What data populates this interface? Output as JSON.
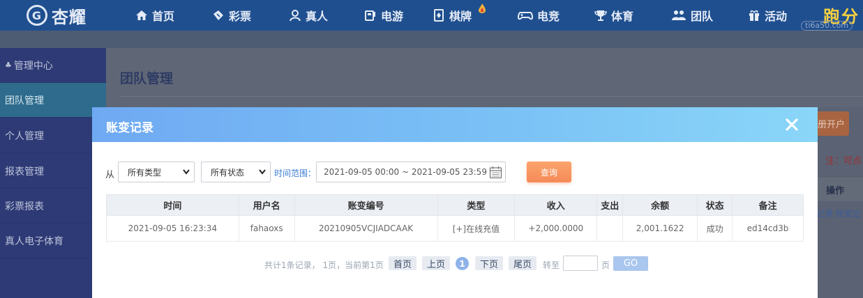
{
  "brand": {
    "logo_text": "杏耀",
    "logo_badge": "G",
    "right_brand": "跑分",
    "watermark": "ti6a50.com"
  },
  "nav": [
    {
      "label": "首页",
      "icon": "home-icon"
    },
    {
      "label": "彩票",
      "icon": "ticket-icon"
    },
    {
      "label": "真人",
      "icon": "person-icon"
    },
    {
      "label": "电游",
      "icon": "slot-icon"
    },
    {
      "label": "棋牌",
      "icon": "cards-icon"
    },
    {
      "label": "电竞",
      "icon": "gamepad-icon"
    },
    {
      "label": "体育",
      "icon": "trophy-icon"
    },
    {
      "label": "团队",
      "icon": "team-icon"
    },
    {
      "label": "活动",
      "icon": "gift-icon"
    }
  ],
  "sidebar": {
    "items": [
      {
        "label": "管理中心",
        "prefix": "♣"
      },
      {
        "label": "团队管理"
      },
      {
        "label": "个人管理"
      },
      {
        "label": "报表管理"
      },
      {
        "label": "彩票报表"
      },
      {
        "label": "真人电子体育"
      }
    ]
  },
  "page": {
    "title": "团队管理",
    "right_button": "册开户",
    "right_note": "注：可点",
    "right_column": "操作",
    "right_links": "记录 账变记"
  },
  "modal": {
    "title": "账变记录",
    "close_icon": "close-icon",
    "filter": {
      "from_label": "从",
      "type_select": "所有类型",
      "status_select": "所有状态",
      "time_label": "时间范围：",
      "date_range": "2021-09-05 00:00 ~ 2021-09-05 23:59",
      "query_button": "查询"
    },
    "table": {
      "headers": [
        "时间",
        "用户名",
        "账变编号",
        "类型",
        "收入",
        "支出",
        "余额",
        "状态",
        "备注"
      ],
      "rows": [
        [
          "2021-09-05 16:23:34",
          "fahaoxs",
          "20210905VCJIADCAAK",
          "[+]在线充值",
          "+2,000.0000",
          "",
          "2,001.1622",
          "成功",
          "ed14cd3b"
        ]
      ]
    },
    "pagination": {
      "summary": "共计1条记录， 1页，当前第1页",
      "first": "首页",
      "prev": "上页",
      "current": "1",
      "next": "下页",
      "last": "尾页",
      "goto_label": "转至",
      "page_unit": "页",
      "go_button": "GO",
      "goto_value": ""
    }
  },
  "colors": {
    "nav_bg": "#1f4f8f",
    "sidebar_bg": "#2e3a75",
    "modal_header": "#7bc3f6",
    "accent_orange": "#f58a58",
    "income_green": "#6a9a1f"
  }
}
